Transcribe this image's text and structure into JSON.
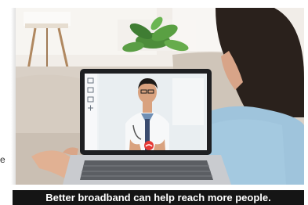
{
  "photo": {
    "description_free": true
  },
  "left_fragment": "e",
  "caption": "Better broadband can help reach more people.",
  "colors": {
    "caption_bg": "#151515",
    "caption_text": "#ffffff",
    "sweater": "#9fc4dc",
    "laptop_frame": "#1e1f22",
    "end_call": "#e53935"
  },
  "icons": [
    "video-call-end-icon",
    "laptop-sidebar-icons"
  ]
}
